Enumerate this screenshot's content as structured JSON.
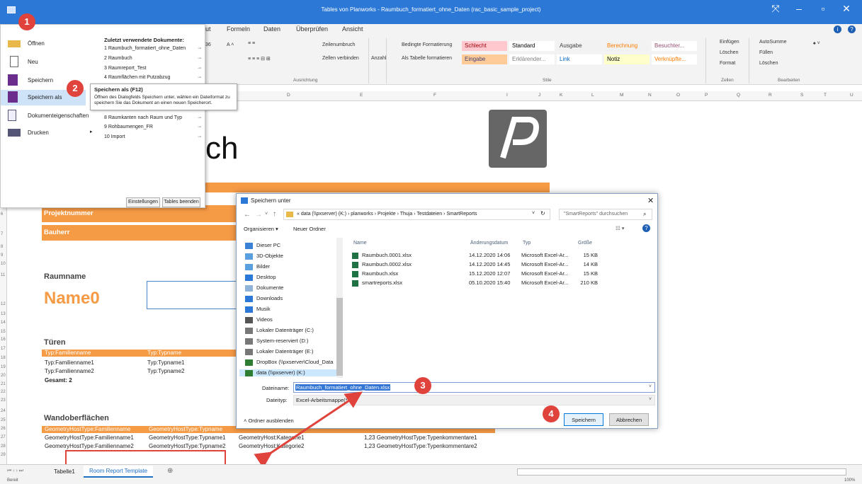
{
  "window": {
    "title": "Tables von Planworks - Raumbuch_formatiert_ohne_Daten  (rac_basic_sample_project)"
  },
  "ribbon": {
    "tabs": [
      "ut",
      "Formeln",
      "Daten",
      "Überprüfen",
      "Ansicht"
    ],
    "font_size": "36",
    "wrap": "Zeilenumbruch",
    "merge": "Zellen verbinden",
    "number": "Anzahl",
    "cond_format": "Bedingte Formatierung",
    "as_table": "Als Tabelle formatieren",
    "styles": [
      {
        "label": "Schlecht",
        "bg": "#ffc7ce",
        "fg": "#9c0006"
      },
      {
        "label": "Standard",
        "bg": "#ffffff",
        "fg": "#000000"
      },
      {
        "label": "Ausgabe",
        "bg": "#f2f2f2",
        "fg": "#3f3f3f"
      },
      {
        "label": "Berechnung",
        "bg": "#f2f2f2",
        "fg": "#fa7d00"
      },
      {
        "label": "Besuchter...",
        "bg": "#ffffff",
        "fg": "#954f72"
      },
      {
        "label": "Eingabe",
        "bg": "#ffcc99",
        "fg": "#3f3f76"
      },
      {
        "label": "Erklärender...",
        "bg": "#ffffff",
        "fg": "#7f7f7f"
      },
      {
        "label": "Link",
        "bg": "#ffffff",
        "fg": "#0563c1"
      },
      {
        "label": "Notiz",
        "bg": "#ffffcc",
        "fg": "#000000"
      },
      {
        "label": "Verknüpfte...",
        "bg": "#ffffff",
        "fg": "#fa7d00"
      }
    ],
    "insert": "Einfügen",
    "delete": "Löschen",
    "format": "Format",
    "autosum": "AutoSumme",
    "fill": "Füllen",
    "clear": "Löschen",
    "groups": {
      "alignment": "Ausrichtung",
      "styles": "Stile",
      "cells": "Zellen",
      "edit": "Bearbeiten"
    }
  },
  "filemenu": {
    "items": [
      "Öffnen",
      "Neu",
      "Speichern",
      "Speichern als",
      "Dokumenteigenschaften",
      "Drucken"
    ],
    "recent_title": "Zuletzt verwendete Dokumente:",
    "recent": [
      "1 Raumbuch_formatiert_ohne_Daten",
      "2 Raumbuch",
      "3 Raumreport_Test",
      "4 Raumflächen mit Putzabzug",
      "8 Raumkanten nach Raum und Typ",
      "9 Rohbaumengen_FR",
      "10 Import"
    ],
    "settings": "Einstellungen",
    "exit": "Tables beenden"
  },
  "tooltip": {
    "title": "Speichern als (F12)",
    "text": "Öffnen des Dialogfelds Speichern unter, wählen ein Dateiformat zu speichern Sie das Dokument an einen neuen Speicherort."
  },
  "columns": [
    "D",
    "E",
    "F",
    "I",
    "J",
    "K",
    "L",
    "M",
    "N",
    "O",
    "P",
    "Q",
    "R",
    "S",
    "T",
    "U"
  ],
  "sheet": {
    "ch": "ch",
    "proj": "Projektnummer",
    "bauherr": "Bauherr",
    "raumname": "Raumname",
    "name0": "Name0",
    "tueren": "Türen",
    "t_h1": "Typ:Familienname",
    "t_h2": "Typ:Typname",
    "t_r1a": "Typ:Familienname1",
    "t_r1b": "Typ:Typname1",
    "t_r2a": "Typ:Familienname2",
    "t_r2b": "Typ:Typname2",
    "gesamt": "Gesamt: 2",
    "wand": "Wandoberflächen",
    "w_h1": "GeometryHostType:Familienname",
    "w_h2": "GeometryHostType:Typname",
    "w_r1a": "GeometryHostType:Familienname1",
    "w_r1b": "GeometryHostType:Typname1",
    "w_r1c": "GeometryHost:Kategorie1",
    "w_r1d": "1,23 GeometryHostType:Typenkommentare1",
    "w_r2a": "GeometryHostType:Familienname2",
    "w_r2b": "GeometryHostType:Typname2",
    "w_r2c": "GeometryHost:Kategorie2",
    "w_r2d": "1,23 GeometryHostType:Typenkommentare2"
  },
  "rows": [
    "6",
    "7",
    "8",
    "9",
    "10",
    "11",
    "12",
    "13",
    "14",
    "15",
    "16",
    "17",
    "18",
    "19",
    "20",
    "21",
    "22",
    "23",
    "24",
    "25",
    "26",
    "27",
    "28",
    "29"
  ],
  "dialog": {
    "title": "Speichern unter",
    "path": [
      "« data (\\\\pxserver) (K:)",
      "planworks",
      "Projekte",
      "Thuja",
      "Testdateien",
      "SmartReports"
    ],
    "search_placeholder": "\"SmartReports\" durchsuchen",
    "organize": "Organisieren",
    "new_folder": "Neuer Ordner",
    "nav": [
      "Dieser PC",
      "3D-Objekte",
      "Bilder",
      "Desktop",
      "Dokumente",
      "Downloads",
      "Musik",
      "Videos",
      "Lokaler Datenträger (C:)",
      "System-reserviert (D:)",
      "Lokaler Datenträger (E:)",
      "DropBox (\\\\pxserver\\Cloud_Data",
      "data (\\\\pxserver) (K:)"
    ],
    "headers": [
      "Name",
      "Änderungsdatum",
      "Typ",
      "Größe"
    ],
    "files": [
      {
        "name": "Raumbuch.0001.xlsx",
        "date": "14.12.2020 14:06",
        "type": "Microsoft Excel-Ar...",
        "size": "15 KB"
      },
      {
        "name": "Raumbuch.0002.xlsx",
        "date": "14.12.2020 14:45",
        "type": "Microsoft Excel-Ar...",
        "size": "14 KB"
      },
      {
        "name": "Raumbuch.xlsx",
        "date": "15.12.2020 12:07",
        "type": "Microsoft Excel-Ar...",
        "size": "15 KB"
      },
      {
        "name": "smartreports.xlsx",
        "date": "05.10.2020 15:40",
        "type": "Microsoft Excel-Ar...",
        "size": "210 KB"
      }
    ],
    "filename_label": "Dateiname:",
    "filename": "Raumbuch_formatiert_ohne_Daten.xlsx",
    "filetype_label": "Dateityp:",
    "filetype": "Excel-Arbeitsmappe(*.xl",
    "hide_folders": "Ordner ausblenden",
    "save": "Speichern",
    "cancel": "Abbrechen"
  },
  "badges": [
    "1",
    "2",
    "3",
    "4"
  ],
  "sheets": [
    "Tabelle1",
    "Room Report Template"
  ],
  "status": {
    "left": "Bereit",
    "zoom": "100%"
  }
}
